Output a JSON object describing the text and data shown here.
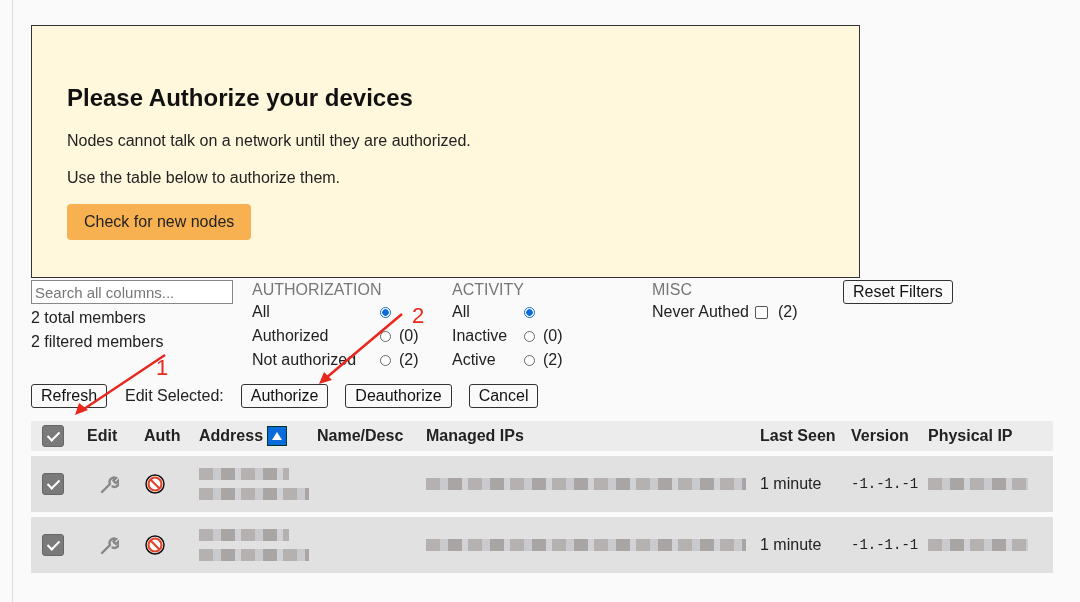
{
  "notice": {
    "title": "Please Authorize your devices",
    "lines": [
      "Nodes cannot talk on a network until they are authorized.",
      "Use the table below to authorize them."
    ],
    "button": "Check for new nodes"
  },
  "search": {
    "placeholder": "Search all columns..."
  },
  "counts": [
    "2 total members",
    "2 filtered members"
  ],
  "filters": [
    {
      "heading": "AUTHORIZATION",
      "kind": "radio",
      "options": [
        {
          "label": "All",
          "selected": true
        },
        {
          "label": "Authorized",
          "selected": false,
          "count": "(0)"
        },
        {
          "label": "Not authorized",
          "selected": false,
          "count": "(2)"
        }
      ]
    },
    {
      "heading": "ACTIVITY",
      "kind": "radio",
      "options": [
        {
          "label": "All",
          "selected": true
        },
        {
          "label": "Inactive",
          "selected": false,
          "count": "(0)"
        },
        {
          "label": "Active",
          "selected": false,
          "count": "(2)"
        }
      ]
    },
    {
      "heading": "MISC",
      "kind": "checkbox",
      "options": [
        {
          "label": "Never Authed",
          "checked": false,
          "count": "(2)"
        }
      ]
    }
  ],
  "reset_button": "Reset Filters",
  "actions": {
    "refresh": "Refresh",
    "label": "Edit Selected:",
    "buttons": [
      "Authorize",
      "Deauthorize",
      "Cancel"
    ]
  },
  "table": {
    "select_all": {
      "checked": true
    },
    "columns": [
      {
        "label": "Edit"
      },
      {
        "label": "Auth"
      },
      {
        "label": "Address",
        "sorted": true
      },
      {
        "label": "Name/Desc"
      },
      {
        "label": "Managed IPs"
      },
      {
        "label": "Last Seen"
      },
      {
        "label": "Version"
      },
      {
        "label": "Physical IP"
      }
    ],
    "rows": [
      {
        "checked": true,
        "authorized": false,
        "last_seen": "1 minute",
        "version": "-1.-1.-1"
      },
      {
        "checked": true,
        "authorized": false,
        "last_seen": "1 minute",
        "version": "-1.-1.-1"
      }
    ]
  },
  "annotations": [
    {
      "label": "1"
    },
    {
      "label": "2"
    }
  ]
}
